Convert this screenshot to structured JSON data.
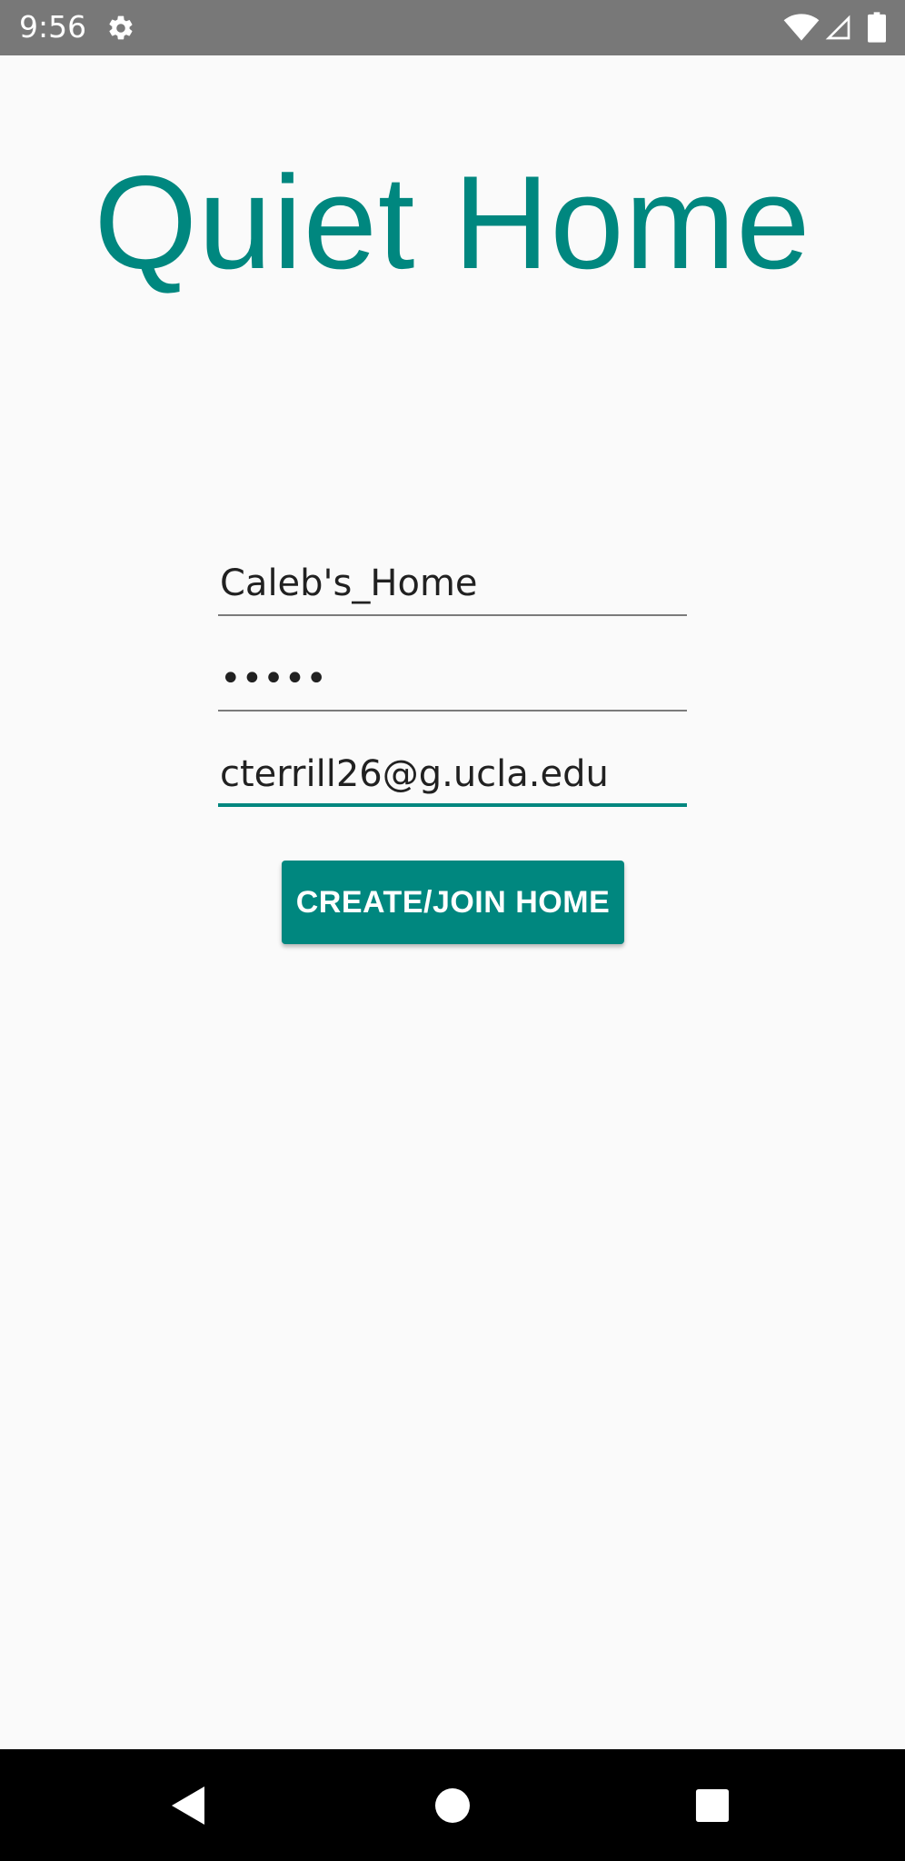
{
  "status_bar": {
    "time": "9:56",
    "icons": [
      "gear-icon",
      "wifi-icon",
      "cell-signal-icon",
      "battery-icon"
    ]
  },
  "app": {
    "title": "Quiet Home"
  },
  "form": {
    "home_name": {
      "value": "Caleb's_Home"
    },
    "password": {
      "value": "•••••"
    },
    "email": {
      "value": "cterrill26@g.ucla.edu"
    },
    "submit_label": "CREATE/JOIN HOME"
  },
  "nav_bar": {
    "icons": [
      "back-icon",
      "home-icon",
      "recents-icon"
    ]
  },
  "colors": {
    "accent": "#00877f",
    "status_bar": "#787878",
    "background": "#fafafa",
    "nav_bar": "#000000"
  }
}
